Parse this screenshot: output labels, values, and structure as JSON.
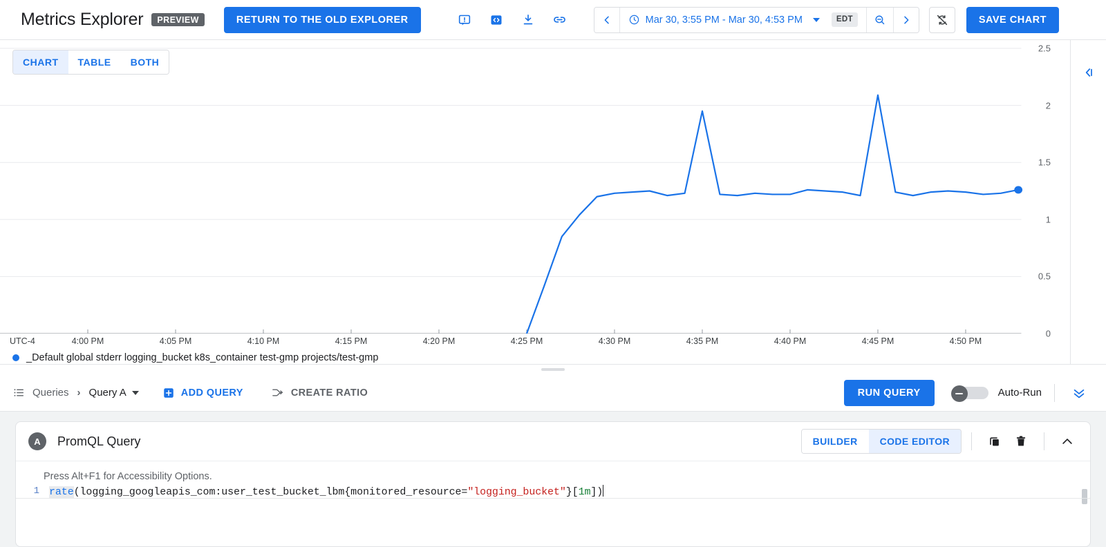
{
  "header": {
    "app_title": "Metrics Explorer",
    "preview_badge": "PREVIEW",
    "return_button": "RETURN TO THE OLD EXPLORER",
    "icons": [
      {
        "name": "alert-icon",
        "label": "Create alert"
      },
      {
        "name": "code-brackets-icon",
        "label": "View code"
      },
      {
        "name": "download-icon",
        "label": "Download"
      },
      {
        "name": "link-icon",
        "label": "Share link"
      }
    ],
    "range": {
      "prev_label": "‹",
      "clock_icon": "clock-icon",
      "text": "Mar 30, 3:55 PM - Mar 30, 4:53 PM",
      "timezone": "EDT",
      "zoom_out_icon": "zoom-out-icon",
      "next_label": "›"
    },
    "sync_icon": "sync-disabled-icon",
    "save_button": "SAVE CHART"
  },
  "chart": {
    "view_tabs": [
      {
        "label": "CHART",
        "active": true
      },
      {
        "label": "TABLE",
        "active": false
      },
      {
        "label": "BOTH",
        "active": false
      }
    ],
    "collapse_icon": "collapse-panel-icon",
    "legend": {
      "color": "#1a73e8",
      "text": "_Default global stderr logging_bucket k8s_container test-gmp projects/test-gmp"
    }
  },
  "chart_data": {
    "type": "line",
    "title": "",
    "xlabel": "",
    "ylabel": "",
    "timezone_label": "UTC-4",
    "grid": true,
    "legend_position": "bottom-left",
    "line_color": "#1a73e8",
    "ylim": [
      0,
      2.5
    ],
    "yticks": [
      0,
      0.5,
      1,
      1.5,
      2,
      2.5
    ],
    "ytick_labels": [
      "0",
      "0.5",
      "1",
      "1.5",
      "2",
      "2.5"
    ],
    "xtick_labels": [
      "4:00 PM",
      "4:05 PM",
      "4:10 PM",
      "4:15 PM",
      "4:20 PM",
      "4:25 PM",
      "4:30 PM",
      "4:35 PM",
      "4:40 PM",
      "4:45 PM",
      "4:50 PM"
    ],
    "xlim": [
      "3:55 PM",
      "4:53 PM"
    ],
    "series": [
      {
        "name": "_Default global stderr logging_bucket k8s_container test-gmp projects/test-gmp",
        "x": [
          "4:25 PM",
          "4:26 PM",
          "4:27 PM",
          "4:28 PM",
          "4:29 PM",
          "4:30 PM",
          "4:31 PM",
          "4:32 PM",
          "4:33 PM",
          "4:34 PM",
          "4:35 PM",
          "4:36 PM",
          "4:37 PM",
          "4:38 PM",
          "4:39 PM",
          "4:40 PM",
          "4:41 PM",
          "4:42 PM",
          "4:43 PM",
          "4:44 PM",
          "4:45 PM",
          "4:46 PM",
          "4:47 PM",
          "4:48 PM",
          "4:49 PM",
          "4:50 PM",
          "4:51 PM",
          "4:52 PM",
          "4:53 PM"
        ],
        "y": [
          0,
          0.42,
          0.85,
          1.04,
          1.2,
          1.23,
          1.24,
          1.25,
          1.21,
          1.23,
          1.95,
          1.22,
          1.21,
          1.23,
          1.22,
          1.22,
          1.26,
          1.25,
          1.24,
          1.21,
          2.09,
          1.24,
          1.21,
          1.24,
          1.25,
          1.24,
          1.22,
          1.23,
          1.26
        ]
      }
    ],
    "last_point_marker": {
      "x": "4:53 PM",
      "y": 1.26
    }
  },
  "query_bar": {
    "list_icon": "list-icon",
    "queries_label": "Queries",
    "separator": "›",
    "current_query": "Query A",
    "add_query_label": "ADD QUERY",
    "add_icon": "plus-square-icon",
    "create_ratio_label": "CREATE RATIO",
    "ratio_icon": "ratio-arrows-icon",
    "run_query_label": "RUN QUERY",
    "auto_run_label": "Auto-Run",
    "auto_run_enabled": false,
    "collapse_icon": "double-chevron-down-icon"
  },
  "query_card": {
    "badge": "A",
    "title": "PromQL Query",
    "mode_tabs": [
      {
        "label": "BUILDER",
        "active": false
      },
      {
        "label": "CODE EDITOR",
        "active": true
      }
    ],
    "duplicate_icon": "copy-icon",
    "delete_icon": "trash-icon",
    "collapse_icon": "chevron-up-icon",
    "editor": {
      "a11y_hint": "Press Alt+F1 for Accessibility Options.",
      "line_number": "1",
      "code_tokens": [
        {
          "text": "rate",
          "type": "fn"
        },
        {
          "text": "(logging_googleapis_com:user_test_bucket_lbm{monitored_resource=",
          "type": "plain"
        },
        {
          "text": "\"logging_bucket\"",
          "type": "str"
        },
        {
          "text": "}[",
          "type": "plain"
        },
        {
          "text": "1m",
          "type": "num"
        },
        {
          "text": "])",
          "type": "plain"
        }
      ],
      "code_full": "rate(logging_googleapis_com:user_test_bucket_lbm{monitored_resource=\"logging_bucket\"}[1m])"
    }
  }
}
